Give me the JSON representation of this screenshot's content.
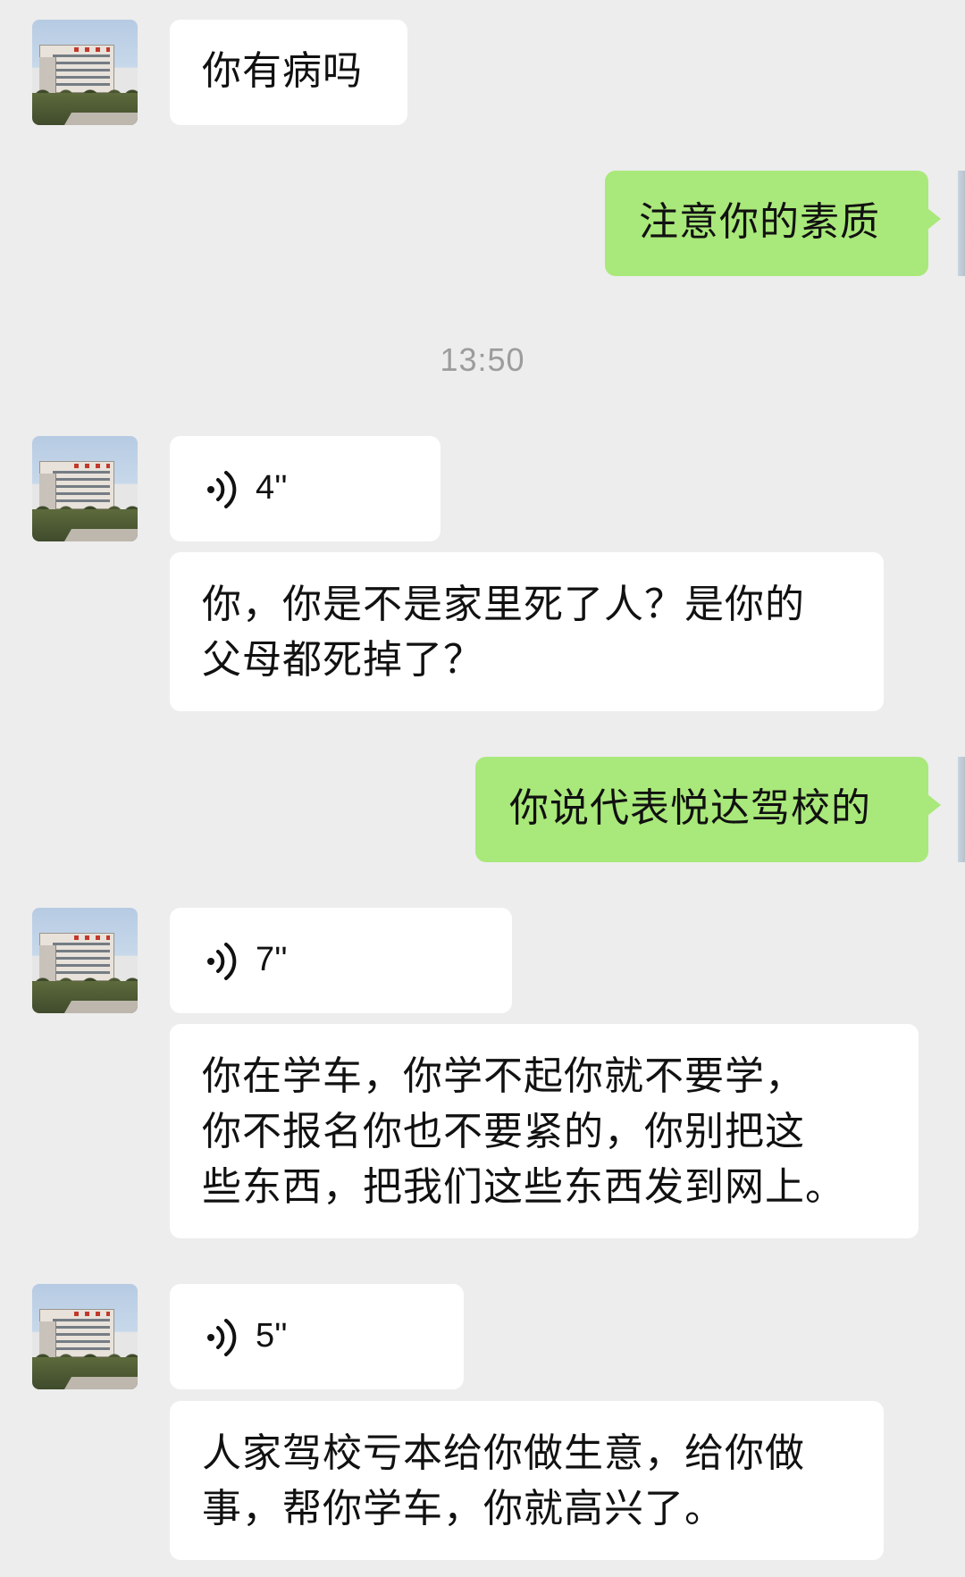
{
  "chat": {
    "timestamp": "13:50",
    "messages": [
      {
        "side": "left",
        "type": "text",
        "text": "你有病吗"
      },
      {
        "side": "right",
        "type": "text",
        "text": "注意你的素质"
      },
      {
        "side": "left",
        "type": "voice",
        "duration": "4''"
      },
      {
        "side": "left",
        "type": "text",
        "lines": [
          "你，你是不是家里死了人？是你的",
          "父母都死掉了？"
        ]
      },
      {
        "side": "right",
        "type": "text",
        "text": "你说代表悦达驾校的"
      },
      {
        "side": "left",
        "type": "voice",
        "duration": "7''"
      },
      {
        "side": "left",
        "type": "text",
        "lines": [
          "你在学车，你学不起你就不要学，",
          "你不报名你也不要紧的，你别把这",
          "些东西，把我们这些东西发到网上。"
        ]
      },
      {
        "side": "left",
        "type": "voice",
        "duration": "5''"
      },
      {
        "side": "left",
        "type": "text",
        "lines": [
          "人家驾校亏本给你做生意，给你做",
          "事，帮你学车，你就高兴了。"
        ]
      }
    ]
  },
  "icons": {
    "voice": "voice-wave-icon",
    "avatar": "building-avatar"
  },
  "colors": {
    "background": "#ededed",
    "left_bubble": "#ffffff",
    "right_bubble": "#a9e87a",
    "timestamp": "#9c9c9c"
  }
}
